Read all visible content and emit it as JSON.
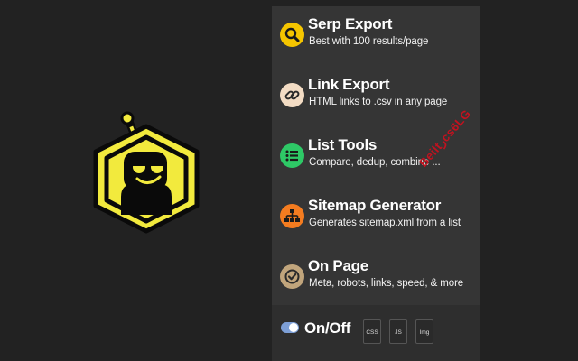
{
  "app": {
    "logo_icon": "robot-hexagon-icon",
    "accent_color": "#f2ea3d"
  },
  "menu": {
    "items": [
      {
        "title": "Serp Export",
        "subtitle": "Best with 100 results/page",
        "icon": "search-icon",
        "icon_color": "#f5c500"
      },
      {
        "title": "Link Export",
        "subtitle": "HTML links to .csv in any page",
        "icon": "link-icon",
        "icon_color": "#f3dcc4"
      },
      {
        "title": "List Tools",
        "subtitle": "Compare, dedup, combine ...",
        "icon": "list-icon",
        "icon_color": "#2ec866"
      },
      {
        "title": "Sitemap Generator",
        "subtitle": "Generates sitemap.xml from a list",
        "icon": "sitemap-icon",
        "icon_color": "#f47c20"
      },
      {
        "title": "On Page",
        "subtitle": "Meta, robots, links, speed, & more",
        "icon": "check-circle-icon",
        "icon_color": "#c1a57c"
      }
    ]
  },
  "footer": {
    "toggle_label": "On/Off",
    "toggle_on": true,
    "toggle_color": "#7d9fd6",
    "chips": [
      "CSS",
      "JS",
      "Img"
    ]
  },
  "watermark": {
    "text": "Beiltرcs6LG",
    "color": "#c1121f"
  }
}
